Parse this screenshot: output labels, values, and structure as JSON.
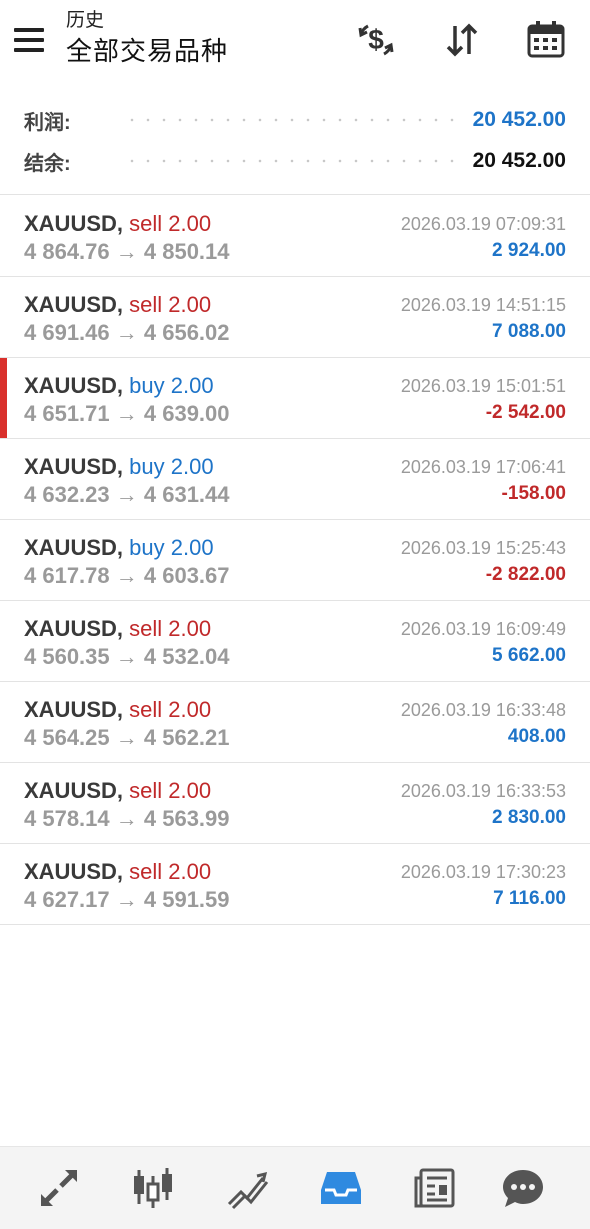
{
  "header": {
    "title_small": "历史",
    "title_large": "全部交易品种"
  },
  "summary": {
    "profit_label": "利润:",
    "profit_value": "20 452.00",
    "balance_label": "结余:",
    "balance_value": "20 452.00"
  },
  "colors": {
    "sell": "#c0292a",
    "buy": "#1e74c8",
    "positive": "#1e74c8",
    "negative": "#c0292a",
    "active_nav": "#2f8ae0",
    "marker": "#d9302c"
  },
  "trades": [
    {
      "symbol": "XAUUSD,",
      "side": "sell",
      "volume": "2.00",
      "open_price": "4 864.76",
      "close_price": "4 850.14",
      "time": "2026.03.19 07:09:31",
      "profit": "2 924.00",
      "profit_sign": "positive",
      "marked": false
    },
    {
      "symbol": "XAUUSD,",
      "side": "sell",
      "volume": "2.00",
      "open_price": "4 691.46",
      "close_price": "4 656.02",
      "time": "2026.03.19 14:51:15",
      "profit": "7 088.00",
      "profit_sign": "positive",
      "marked": false
    },
    {
      "symbol": "XAUUSD,",
      "side": "buy",
      "volume": "2.00",
      "open_price": "4 651.71",
      "close_price": "4 639.00",
      "time": "2026.03.19 15:01:51",
      "profit": "-2 542.00",
      "profit_sign": "negative",
      "marked": true
    },
    {
      "symbol": "XAUUSD,",
      "side": "buy",
      "volume": "2.00",
      "open_price": "4 632.23",
      "close_price": "4 631.44",
      "time": "2026.03.19 17:06:41",
      "profit": "-158.00",
      "profit_sign": "negative",
      "marked": false
    },
    {
      "symbol": "XAUUSD,",
      "side": "buy",
      "volume": "2.00",
      "open_price": "4 617.78",
      "close_price": "4 603.67",
      "time": "2026.03.19 15:25:43",
      "profit": "-2 822.00",
      "profit_sign": "negative",
      "marked": false
    },
    {
      "symbol": "XAUUSD,",
      "side": "sell",
      "volume": "2.00",
      "open_price": "4 560.35",
      "close_price": "4 532.04",
      "time": "2026.03.19 16:09:49",
      "profit": "5 662.00",
      "profit_sign": "positive",
      "marked": false
    },
    {
      "symbol": "XAUUSD,",
      "side": "sell",
      "volume": "2.00",
      "open_price": "4 564.25",
      "close_price": "4 562.21",
      "time": "2026.03.19 16:33:48",
      "profit": "408.00",
      "profit_sign": "positive",
      "marked": false
    },
    {
      "symbol": "XAUUSD,",
      "side": "sell",
      "volume": "2.00",
      "open_price": "4 578.14",
      "close_price": "4 563.99",
      "time": "2026.03.19 16:33:53",
      "profit": "2 830.00",
      "profit_sign": "positive",
      "marked": false
    },
    {
      "symbol": "XAUUSD,",
      "side": "sell",
      "volume": "2.00",
      "open_price": "4 627.17",
      "close_price": "4 591.59",
      "time": "2026.03.19 17:30:23",
      "profit": "7 116.00",
      "profit_sign": "positive",
      "marked": false
    }
  ],
  "header_icons": [
    "currency-exchange-icon",
    "sort-icon",
    "calendar-icon"
  ],
  "bottom_nav": [
    {
      "icon": "quotes-icon",
      "active": false
    },
    {
      "icon": "candlestick-chart-icon",
      "active": false
    },
    {
      "icon": "trade-icon",
      "active": false
    },
    {
      "icon": "history-inbox-icon",
      "active": true
    },
    {
      "icon": "news-icon",
      "active": false
    },
    {
      "icon": "chat-icon",
      "active": false
    }
  ]
}
